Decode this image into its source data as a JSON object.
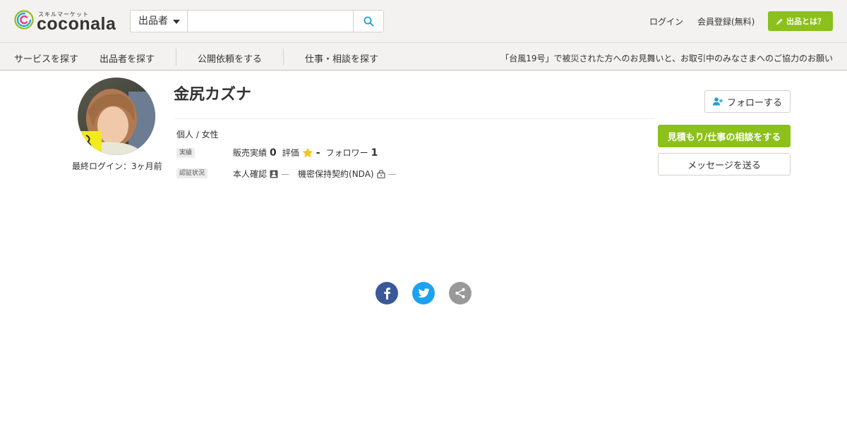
{
  "header": {
    "logo_small": "スキルマーケット",
    "logo_text": "coconala",
    "search_select": "出品者",
    "search_placeholder": "",
    "login": "ログイン",
    "register": "会員登録(無料)",
    "seller_button": "出品とは？"
  },
  "nav": {
    "items": [
      "サービスを探す",
      "出品者を探す",
      "公開依頼をする",
      "仕事・相談を探す"
    ],
    "notice": "「台風19号」で被災された方へのお見舞いと、お取引中のみなさまへのご協力のお願い"
  },
  "profile": {
    "name": "金尻カズナ",
    "last_login": "最終ログイン：3ヶ月前",
    "type_gender": "個人 / 女性",
    "badge_results": "実績",
    "sales_label": "販売実績",
    "sales_value": "0",
    "rating_label": "評価",
    "rating_value": "-",
    "follower_label": "フォロワー",
    "follower_value": "1",
    "badge_verify": "認証状況",
    "identity_label": "本人確認",
    "identity_value": "—",
    "nda_label": "機密保持契約(NDA)",
    "nda_value": "—"
  },
  "actions": {
    "follow": "フォローする",
    "estimate": "見積もり/仕事の相談をする",
    "message": "メッセージを送る"
  },
  "colors": {
    "accent_green": "#8cc01a",
    "facebook": "#3b5998",
    "twitter": "#1da1f2",
    "share": "#999999",
    "star": "#f5c518"
  },
  "share_icons": [
    "facebook-icon",
    "twitter-icon",
    "share-icon"
  ]
}
